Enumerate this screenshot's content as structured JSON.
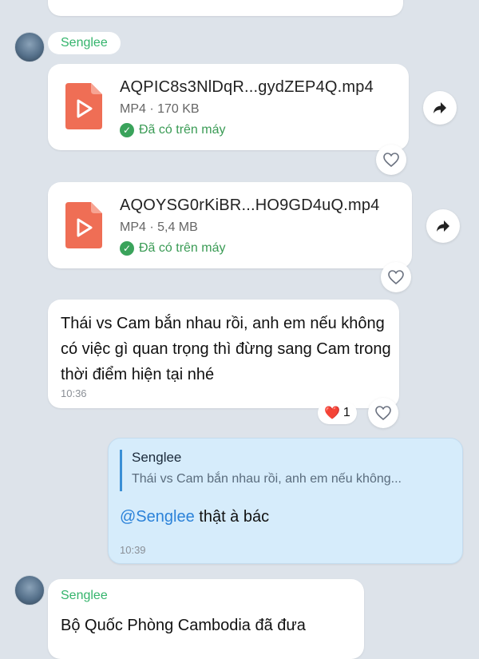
{
  "colors": {
    "background": "#dde3ea",
    "bubble_incoming": "#ffffff",
    "bubble_outgoing": "#d6ecfb",
    "sender_name": "#34b46c",
    "status_green": "#3a9b55",
    "mention_blue": "#2b82d9",
    "file_icon": "#ef6e55"
  },
  "messages": {
    "group1": {
      "sender": "Senglee",
      "files": [
        {
          "name": "AQPIC8s3NlDqR...gydZEP4Q.mp4",
          "meta": "MP4 · 170 KB",
          "status": "Đã có trên máy",
          "icon": "video-file-icon"
        },
        {
          "name": "AQOYSG0rKiBR...HO9GD4uQ.mp4",
          "meta": "MP4 · 5,4 MB",
          "status": "Đã có trên máy",
          "icon": "video-file-icon"
        }
      ],
      "text": {
        "body": "Thái vs Cam bắn nhau rồi, anh em nếu không có việc gì quan trọng thì đừng sang Cam trong thời điểm hiện tại nhé",
        "time": "10:36",
        "reaction": {
          "emoji": "❤️",
          "count": "1"
        }
      }
    },
    "reply": {
      "quote_name": "Senglee",
      "quote_text": "Thái vs Cam bắn nhau rồi, anh em nếu không...",
      "mention": "@Senglee",
      "text": " thật à bác",
      "time": "10:39"
    },
    "group2": {
      "sender": "Senglee",
      "text": "Bộ Quốc Phòng Cambodia đã đưa"
    }
  }
}
